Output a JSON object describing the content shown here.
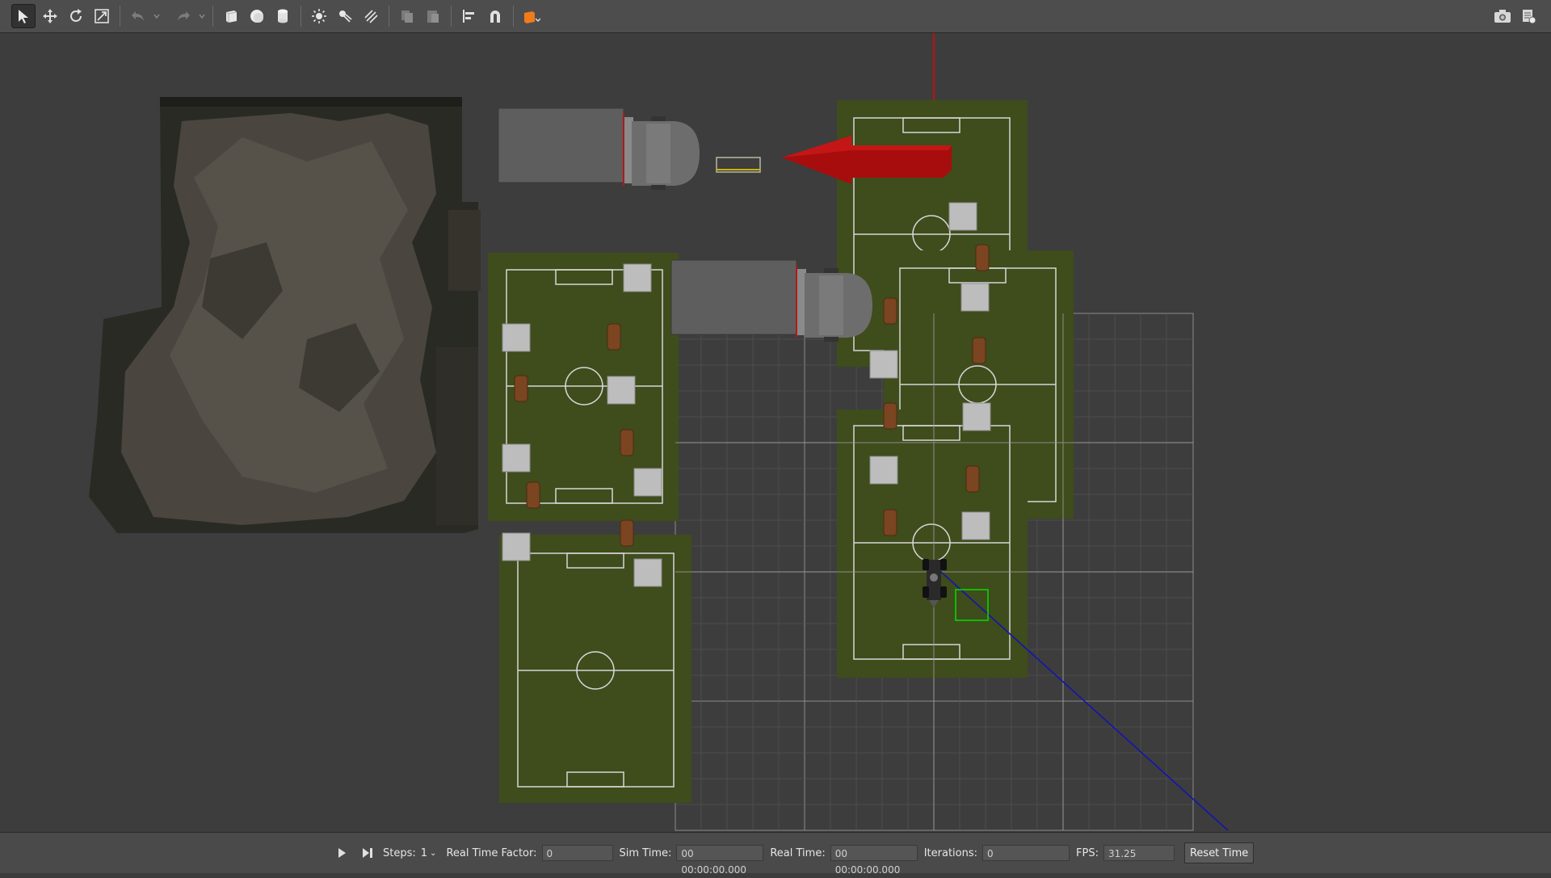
{
  "toolbar": {
    "tools": [
      {
        "name": "select-mode-icon"
      },
      {
        "name": "translate-mode-icon"
      },
      {
        "name": "rotate-mode-icon"
      },
      {
        "name": "scale-mode-icon"
      },
      {
        "name": "undo-icon"
      },
      {
        "name": "redo-icon"
      },
      {
        "name": "box-shape-icon"
      },
      {
        "name": "sphere-shape-icon"
      },
      {
        "name": "cylinder-shape-icon"
      },
      {
        "name": "point-light-icon"
      },
      {
        "name": "spot-light-icon"
      },
      {
        "name": "directional-light-icon"
      },
      {
        "name": "copy-icon"
      },
      {
        "name": "paste-icon"
      },
      {
        "name": "align-icon"
      },
      {
        "name": "snap-icon"
      },
      {
        "name": "view-angle-icon"
      },
      {
        "name": "screenshot-icon"
      },
      {
        "name": "log-icon"
      }
    ],
    "colors": {
      "active_bg": "#323232",
      "view_angle_accent": "#f07b1a"
    }
  },
  "scene": {
    "colors": {
      "background": "#3d3d3d",
      "field_green": "#3f4c1c",
      "field_lines": "#d6d6d6",
      "grid": "#8a8a8a",
      "arrow_red": "#a80d0d",
      "x_axis": "#c01010",
      "y_axis": "#1010b0",
      "selection": "#00e000"
    }
  },
  "bottombar": {
    "play_icon": "play-icon",
    "step_icon": "step-icon",
    "steps_label": "Steps:",
    "steps_value": "1",
    "rtf_label": "Real Time Factor:",
    "rtf_value": "0",
    "sim_time_label": "Sim Time:",
    "sim_time_value": "00 00:00:00.000",
    "real_time_label": "Real Time:",
    "real_time_value": "00 00:00:00.000",
    "iterations_label": "Iterations:",
    "iterations_value": "0",
    "fps_label": "FPS:",
    "fps_value": "31.25",
    "reset_label": "Reset Time"
  }
}
